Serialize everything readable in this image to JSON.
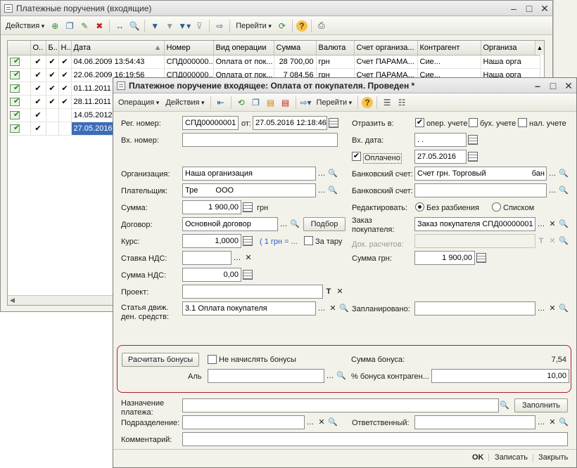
{
  "list_window": {
    "title": "Платежные поручения (входящие)",
    "toolbar": {
      "actions": "Действия",
      "goto": "Перейти",
      "help": "?"
    },
    "columns": [
      "",
      "О..",
      "Б..",
      "Н..",
      "Дата",
      "Номер",
      "Вид операции",
      "Сумма",
      "Валюта",
      "Счет организа...",
      "Контрагент",
      "Организа"
    ],
    "rows": [
      {
        "o": "✔",
        "b": "✔",
        "n": "✔",
        "date": "04.06.2009 13:54:43",
        "number": "СПД000000...",
        "op": "Оплата от пок...",
        "sum": "28 700,00",
        "cur": "грн",
        "acc": "Счет ПАРАМА...",
        "cp": "Сие...",
        "org": "Наша орга"
      },
      {
        "o": "✔",
        "b": "✔",
        "n": "✔",
        "date": "22.06.2009 16:19:56",
        "number": "СПД000000...",
        "op": "Оплата от пок...",
        "sum": "7 084,56",
        "cur": "грн",
        "acc": "Счет ПАРАМА...",
        "cp": "Сие...",
        "org": "Наша орга"
      },
      {
        "o": "✔",
        "b": "✔",
        "n": "✔",
        "date": "01.11.2011",
        "number": "",
        "op": "",
        "sum": "",
        "cur": "",
        "acc": "",
        "cp": "",
        "org": ""
      },
      {
        "o": "✔",
        "b": "✔",
        "n": "✔",
        "date": "28.11.2011",
        "number": "",
        "op": "",
        "sum": "",
        "cur": "",
        "acc": "",
        "cp": "",
        "org": ""
      },
      {
        "o": "✔",
        "b": "",
        "n": "",
        "date": "14.05.2012",
        "number": "",
        "op": "",
        "sum": "",
        "cur": "",
        "acc": "",
        "cp": "",
        "org": ""
      },
      {
        "o": "✔",
        "b": "",
        "n": "",
        "date": "27.05.2016",
        "number": "",
        "op": "",
        "sum": "",
        "cur": "",
        "acc": "",
        "cp": "",
        "org": "",
        "selected": true
      }
    ]
  },
  "doc_window": {
    "title": "Платежное поручение входящее: Оплата от покупателя. Проведен *",
    "toolbar": {
      "operation": "Операция",
      "actions": "Действия",
      "goto": "Перейти",
      "help": "?"
    },
    "fields": {
      "reg_number_label": "Рег. номер:",
      "reg_number": "СПД00000001",
      "from_label": "от:",
      "reg_date": "27.05.2016 12:18:46",
      "in_number_label": "Вх. номер:",
      "in_number": "",
      "reflect_label": "Отразить в:",
      "oper_label": "опер. учете",
      "buh_label": "бух. учете",
      "nal_label": "нал. учете",
      "in_date_label": "Вх. дата:",
      "in_date": " .  .",
      "paid_label": "Оплачено",
      "paid_date": "27.05.2016",
      "org_label": "Организация:",
      "org": "Наша организация",
      "bank_acc_label": "Банковский счет:",
      "bank_acc": "Счет грн. Торговый",
      "bank_acc_tail": "бан",
      "payer_label": "Плательщик:",
      "payer": "Тре",
      "payer_tail": "ООО",
      "bank_acc2_label": "Банковский счет:",
      "bank_acc2": "",
      "sum_label": "Сумма:",
      "sum": "1 900,00",
      "currency": "грн",
      "edit_label": "Редактировать:",
      "no_split": "Без разбиения",
      "by_list": "Списком",
      "contract_label": "Договор:",
      "contract": "Основной договор",
      "pick_btn": "Подбор",
      "order_label": "Заказ покупателя:",
      "order": "Заказ покупателя СПД00000001",
      "rate_label": "Курс:",
      "rate": "1,0000",
      "rate_note": "( 1 грн = ...",
      "tara_label": "За тару",
      "doc_calc_label": "Док. расчетов:",
      "vat_rate_label": "Ставка НДС:",
      "vat_rate": "",
      "sum_uah_label": "Сумма грн:",
      "sum_uah": "1 900,00",
      "vat_sum_label": "Сумма НДС:",
      "vat_sum": "0,00",
      "project_label": "Проект:",
      "project": "",
      "cashflow_label": "Статья движ. ден. средств:",
      "cashflow": "3.1 Оплата покупателя",
      "planned_label": "Запланировано:",
      "planned": "",
      "calc_bonus_btn": "Расчитать бонусы",
      "no_bonus_label": "Не начислять бонусы",
      "bonus_sum_label": "Сумма бонуса:",
      "bonus_sum": "7,54",
      "alt_label": "Аль",
      "alt": "",
      "bonus_pct_label": "% бонуса контраген...",
      "bonus_pct": "10,00",
      "purpose_label": "Назначение платежа:",
      "purpose": "",
      "fill_btn": "Заполнить",
      "dept_label": "Подразделение:",
      "dept": "",
      "resp_label": "Ответственный:",
      "resp": "",
      "comment_label": "Комментарий:",
      "comment": ""
    },
    "footer": {
      "ok": "OK",
      "save": "Записать",
      "close": "Закрыть"
    }
  }
}
